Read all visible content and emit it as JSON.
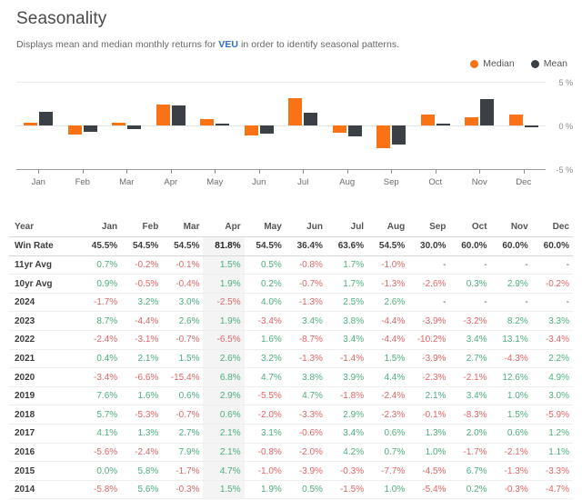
{
  "header": {
    "title": "Seasonality",
    "subtitle_before": "Displays mean and median monthly returns for ",
    "ticker": "VEU",
    "subtitle_after": " in order to identify seasonal patterns."
  },
  "legend": {
    "median_label": "Median",
    "mean_label": "Mean",
    "median_color": "#f97316",
    "mean_color": "#3b3f46"
  },
  "chart_data": {
    "type": "bar",
    "title": "Seasonality",
    "xlabel": "",
    "ylabel": "%",
    "ylim": [
      -5,
      5
    ],
    "grid": true,
    "legend_position": "top-right",
    "categories": [
      "Jan",
      "Feb",
      "Mar",
      "Apr",
      "May",
      "Jun",
      "Jul",
      "Aug",
      "Sep",
      "Oct",
      "Nov",
      "Dec"
    ],
    "ytick_labels": [
      "5 %",
      "0 %",
      "-5 %"
    ],
    "ytick_values": [
      5,
      0,
      -5
    ],
    "series": [
      {
        "name": "Median",
        "color": "#f97316",
        "values": [
          0.3,
          -1.0,
          0.3,
          2.4,
          0.7,
          -1.1,
          3.1,
          -0.8,
          -2.6,
          1.2,
          0.9,
          1.2
        ]
      },
      {
        "name": "Mean",
        "color": "#3b3f46",
        "values": [
          1.6,
          -0.7,
          -0.4,
          2.3,
          0.1,
          -0.9,
          1.5,
          -1.2,
          -2.2,
          0.2,
          3.0,
          -0.2
        ]
      }
    ]
  },
  "table": {
    "columns": [
      "Year",
      "Jan",
      "Feb",
      "Mar",
      "Apr",
      "May",
      "Jun",
      "Jul",
      "Aug",
      "Sep",
      "Oct",
      "Nov",
      "Dec"
    ],
    "highlight_column": "Apr",
    "rows": [
      {
        "label": "Win Rate",
        "type": "winrate",
        "values": [
          "45.5%",
          "54.5%",
          "54.5%",
          "81.8%",
          "54.5%",
          "36.4%",
          "63.6%",
          "54.5%",
          "30.0%",
          "60.0%",
          "60.0%",
          "60.0%"
        ]
      },
      {
        "label": "11yr Avg",
        "type": "avg",
        "values": [
          "0.7%",
          "-0.2%",
          "-0.1%",
          "1.5%",
          "0.5%",
          "-0.8%",
          "1.7%",
          "-1.0%",
          "-",
          "-",
          "-",
          "-"
        ]
      },
      {
        "label": "10yr Avg",
        "type": "avg",
        "values": [
          "0.9%",
          "-0.5%",
          "-0.4%",
          "1.9%",
          "0.2%",
          "-0.7%",
          "1.7%",
          "-1.3%",
          "-2.6%",
          "0.3%",
          "2.9%",
          "-0.2%"
        ]
      },
      {
        "label": "2024",
        "type": "year",
        "values": [
          "-1.7%",
          "3.2%",
          "3.0%",
          "-2.5%",
          "4.0%",
          "-1.3%",
          "2.5%",
          "2.6%",
          "-",
          "-",
          "-",
          "-"
        ]
      },
      {
        "label": "2023",
        "type": "year",
        "values": [
          "8.7%",
          "-4.4%",
          "2.6%",
          "1.9%",
          "-3.4%",
          "3.4%",
          "3.8%",
          "-4.4%",
          "-3.9%",
          "-3.2%",
          "8.2%",
          "3.3%"
        ]
      },
      {
        "label": "2022",
        "type": "year",
        "values": [
          "-2.4%",
          "-3.1%",
          "-0.7%",
          "-6.5%",
          "1.6%",
          "-8.7%",
          "3.4%",
          "-4.4%",
          "-10.2%",
          "3.4%",
          "13.1%",
          "-3.4%"
        ]
      },
      {
        "label": "2021",
        "type": "year",
        "values": [
          "0.4%",
          "2.1%",
          "1.5%",
          "2.6%",
          "3.2%",
          "-1.3%",
          "-1.4%",
          "1.5%",
          "-3.9%",
          "2.7%",
          "-4.3%",
          "2.2%"
        ]
      },
      {
        "label": "2020",
        "type": "year",
        "values": [
          "-3.4%",
          "-6.6%",
          "-15.4%",
          "6.8%",
          "4.7%",
          "3.8%",
          "3.9%",
          "4.4%",
          "-2.3%",
          "-2.1%",
          "12.6%",
          "4.9%"
        ]
      },
      {
        "label": "2019",
        "type": "year",
        "values": [
          "7.6%",
          "1.6%",
          "0.6%",
          "2.9%",
          "-5.5%",
          "4.7%",
          "-1.8%",
          "-2.4%",
          "2.1%",
          "3.4%",
          "1.0%",
          "3.0%"
        ]
      },
      {
        "label": "2018",
        "type": "year",
        "values": [
          "5.7%",
          "-5.3%",
          "-0.7%",
          "0.6%",
          "-2.0%",
          "-3.3%",
          "2.9%",
          "-2.3%",
          "-0.1%",
          "-8.3%",
          "1.5%",
          "-5.9%"
        ]
      },
      {
        "label": "2017",
        "type": "year",
        "values": [
          "4.1%",
          "1.3%",
          "2.7%",
          "2.1%",
          "3.1%",
          "-0.6%",
          "3.4%",
          "0.6%",
          "1.3%",
          "2.0%",
          "0.6%",
          "1.2%"
        ]
      },
      {
        "label": "2016",
        "type": "year",
        "values": [
          "-5.6%",
          "-2.4%",
          "7.9%",
          "2.1%",
          "-0.8%",
          "-2.0%",
          "4.2%",
          "0.7%",
          "1.0%",
          "-1.7%",
          "-2.1%",
          "1.1%"
        ]
      },
      {
        "label": "2015",
        "type": "year",
        "values": [
          "0.0%",
          "5.8%",
          "-1.7%",
          "4.7%",
          "-1.0%",
          "-3.9%",
          "-0.3%",
          "-7.7%",
          "-4.5%",
          "6.7%",
          "-1.3%",
          "-3.3%"
        ]
      },
      {
        "label": "2014",
        "type": "year",
        "values": [
          "-5.8%",
          "5.6%",
          "-0.3%",
          "1.5%",
          "1.9%",
          "0.5%",
          "-1.5%",
          "1.0%",
          "-5.4%",
          "0.2%",
          "-0.3%",
          "-4.7%"
        ]
      }
    ]
  }
}
